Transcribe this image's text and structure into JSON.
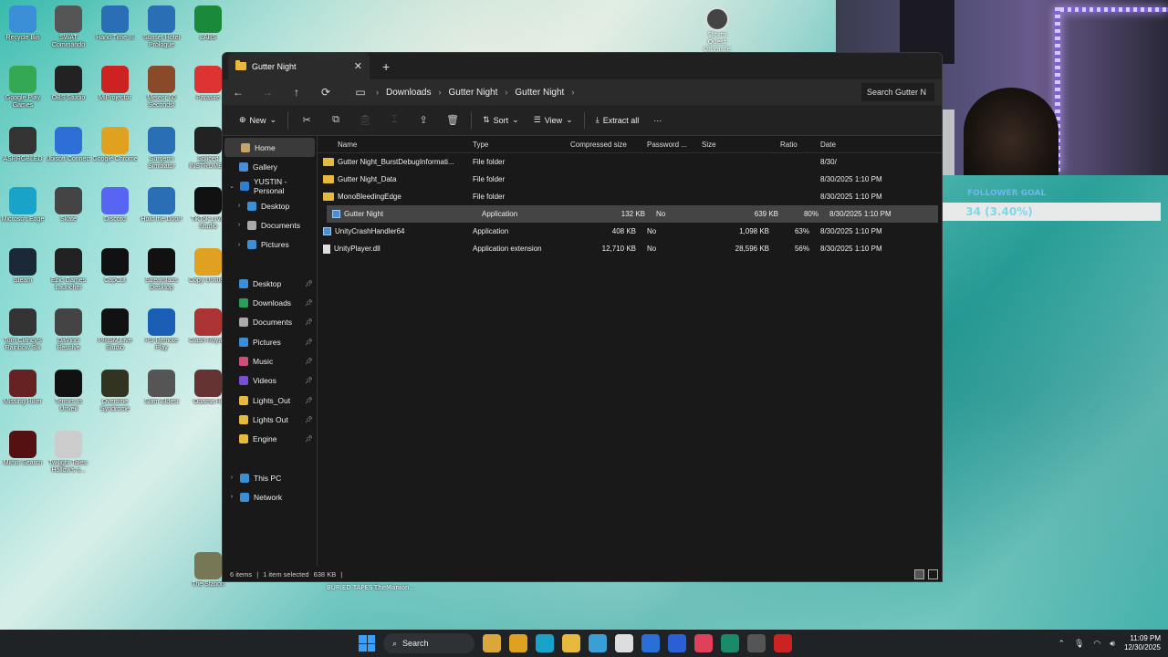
{
  "desktop": {
    "icons": [
      {
        "label": "Recycle Bin",
        "color": "#3a8fd6"
      },
      {
        "label": "SWAT Commando",
        "color": "#555"
      },
      {
        "label": "Hand Time III",
        "color": "#2a6fb5"
      },
      {
        "label": "Sunset Hotel Prologue",
        "color": "#2a6fb5"
      },
      {
        "label": "LABS",
        "color": "#1a8a3a"
      },
      {
        "label": "Google Play Games",
        "color": "#34a853"
      },
      {
        "label": "OBS Studio",
        "color": "#222"
      },
      {
        "label": "MiProjector",
        "color": "#c22"
      },
      {
        "label": "Meteor 60 Seconds!",
        "color": "#8a4a2a"
      },
      {
        "label": "Parasite",
        "color": "#d33"
      },
      {
        "label": "ASRRGBLED",
        "color": "#333"
      },
      {
        "label": "Ubisoft Connect",
        "color": "#2d6fd6"
      },
      {
        "label": "Google Chrome",
        "color": "#e0a020"
      },
      {
        "label": "Surgeon Simulator",
        "color": "#2a6fb5"
      },
      {
        "label": "Spliced INSTRUMEN",
        "color": "#222"
      },
      {
        "label": "Microsoft Edge",
        "color": "#1aa3c8"
      },
      {
        "label": "Skate",
        "color": "#444"
      },
      {
        "label": "Discord",
        "color": "#5865f2"
      },
      {
        "label": "Hold the Door!",
        "color": "#2a6fb5"
      },
      {
        "label": "TikTok LIVE Studio",
        "color": "#111"
      },
      {
        "label": "Steam",
        "color": "#1b2838"
      },
      {
        "label": "Epic Games Launcher",
        "color": "#222"
      },
      {
        "label": "CapCut",
        "color": "#111"
      },
      {
        "label": "Streamlabs Desktop",
        "color": "#111"
      },
      {
        "label": "Copy Untitled",
        "color": "#e0a020"
      },
      {
        "label": "Tom Clancy's Rainbow Six",
        "color": "#333"
      },
      {
        "label": "DaVinci Resolve",
        "color": "#444"
      },
      {
        "label": "PRISM Live Studio",
        "color": "#111"
      },
      {
        "label": "PS Remote Play",
        "color": "#1a5fb5"
      },
      {
        "label": "Clash Royale",
        "color": "#a33"
      },
      {
        "label": "Missing Hiker",
        "color": "#622"
      },
      {
        "label": "Terrors to Unveil",
        "color": "#111"
      },
      {
        "label": "Overtime Syndrome",
        "color": "#332"
      },
      {
        "label": "Slam Eldest",
        "color": "#555"
      },
      {
        "label": "Obama Hr",
        "color": "#633"
      },
      {
        "label": "Mimic Search",
        "color": "#511"
      },
      {
        "label": "Twilight Tales: Hollow's s...",
        "color": "#ccc"
      },
      {
        "label": "The Station",
        "color": "#775"
      }
    ],
    "corner_icon_label": "Storm Quest Ultimate",
    "bottom_labels": [
      "BURIED TAPES U...",
      "TheManion..."
    ]
  },
  "explorer": {
    "tab_title": "Gutter Night",
    "tab_close": "✕",
    "new_tab": "+",
    "nav": {
      "back": "←",
      "forward": "→",
      "up": "↑",
      "refresh": "⟳",
      "view": "▭"
    },
    "breadcrumbs": [
      "Downloads",
      "Gutter Night",
      "Gutter Night"
    ],
    "search_placeholder": "Search Gutter N",
    "toolbar": {
      "new_label": "New",
      "sort_label": "Sort",
      "view_label": "View",
      "extract_label": "Extract all",
      "more_label": "···"
    },
    "nav_pane": [
      {
        "label": "Home",
        "selected": true,
        "color": "#c8a46a"
      },
      {
        "label": "Gallery",
        "color": "#4a8fd6"
      },
      {
        "label": "YUSTIN - Personal",
        "color": "#2d7fd6",
        "expanded": true
      },
      {
        "label": "Desktop",
        "color": "#3a8fd6",
        "indent": true
      },
      {
        "label": "Documents",
        "color": "#aaa",
        "indent": true
      },
      {
        "label": "Pictures",
        "color": "#3a8fd6",
        "indent": true
      },
      {
        "label": "",
        "spacer": true
      },
      {
        "label": "Desktop",
        "color": "#3a8fd6",
        "pinned": true
      },
      {
        "label": "Downloads",
        "color": "#2a9f5a",
        "pinned": true
      },
      {
        "label": "Documents",
        "color": "#aaa",
        "pinned": true
      },
      {
        "label": "Pictures",
        "color": "#3a8fd6",
        "pinned": true
      },
      {
        "label": "Music",
        "color": "#d0507a",
        "pinned": true
      },
      {
        "label": "Videos",
        "color": "#7a4fd6",
        "pinned": true
      },
      {
        "label": "Lights_Out",
        "color": "#e8b93f",
        "pinned": true
      },
      {
        "label": "Lights Out",
        "color": "#e8b93f",
        "pinned": true
      },
      {
        "label": "Engine",
        "color": "#e8b93f",
        "pinned": true
      },
      {
        "label": "",
        "spacer": true
      },
      {
        "label": "This PC",
        "color": "#3a8fd6",
        "collapsed": true
      },
      {
        "label": "Network",
        "color": "#3a8fd6",
        "collapsed": true
      }
    ],
    "columns": [
      "Name",
      "Type",
      "Compressed size",
      "Password ...",
      "Size",
      "Ratio",
      "Date"
    ],
    "files": [
      {
        "name": "Gutter Night_BurstDebugInformati...",
        "type": "File folder",
        "comp": "",
        "pass": "",
        "size": "",
        "ratio": "",
        "date": "8/30/",
        "kind": "folder"
      },
      {
        "name": "Gutter Night_Data",
        "type": "File folder",
        "comp": "",
        "pass": "",
        "size": "",
        "ratio": "",
        "date": "8/30/2025 1:10 PM",
        "kind": "folder"
      },
      {
        "name": "MonoBleedingEdge",
        "type": "File folder",
        "comp": "",
        "pass": "",
        "size": "",
        "ratio": "",
        "date": "8/30/2025 1:10 PM",
        "kind": "folder"
      },
      {
        "name": "Gutter Night",
        "type": "Application",
        "comp": "132 KB",
        "pass": "No",
        "size": "639 KB",
        "ratio": "80%",
        "date": "8/30/2025 1:10 PM",
        "kind": "app",
        "selected": true
      },
      {
        "name": "UnityCrashHandler64",
        "type": "Application",
        "comp": "408 KB",
        "pass": "No",
        "size": "1,098 KB",
        "ratio": "63%",
        "date": "8/30/2025 1:10 PM",
        "kind": "app"
      },
      {
        "name": "UnityPlayer.dll",
        "type": "Application extension",
        "comp": "12,710 KB",
        "pass": "No",
        "size": "28,596 KB",
        "ratio": "56%",
        "date": "8/30/2025 1:10 PM",
        "kind": "dll"
      }
    ],
    "status": {
      "items": "6 items",
      "selected": "1 item selected",
      "size": "638 KB"
    }
  },
  "overlay": {
    "goal_title": "FOLLOWER GOAL",
    "goal_text": "34 (3.40%)",
    "goal_fraction": 0.034
  },
  "taskbar": {
    "search_label": "Search",
    "time": "11:09 PM",
    "date": "12/30/2025",
    "app_colors": [
      "#d9a73a",
      "#e0a020",
      "#1aa3c8",
      "#e8b93f",
      "#3a9fd6",
      "#ddd",
      "#2a6fd6",
      "#2a5fd6",
      "#e0405a",
      "#1a8a6a",
      "#555",
      "#c22"
    ]
  }
}
